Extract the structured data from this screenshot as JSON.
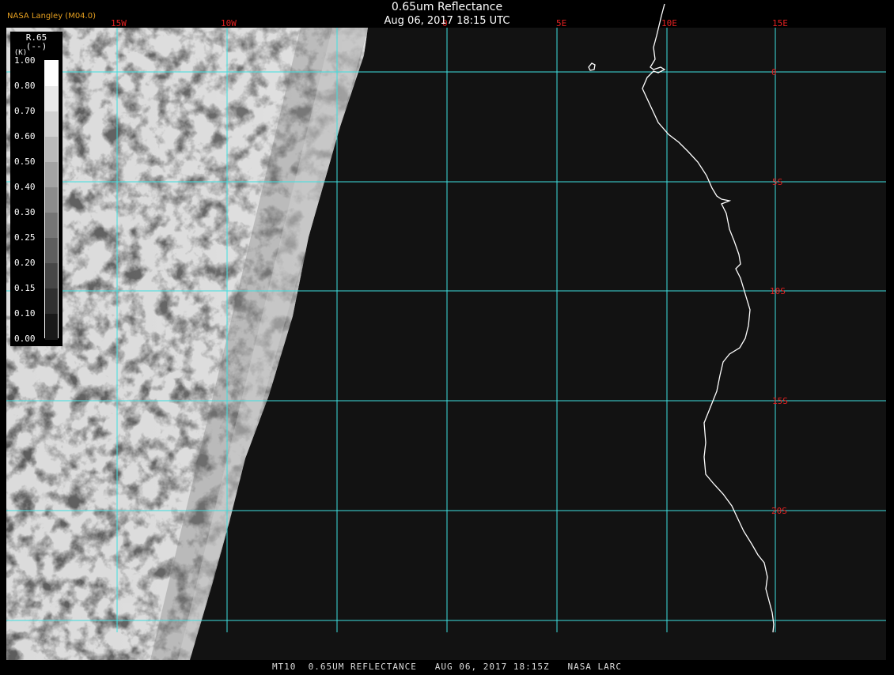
{
  "header": {
    "agency": "NASA Langley (M04.0)",
    "title": "0.65um Reflectance",
    "subtitle": "Aug 06, 2017 18:15 UTC"
  },
  "footer": {
    "text": "MT10  0.65UM REFLECTANCE   AUG 06, 2017 18:15Z   NASA LARC"
  },
  "legend": {
    "variable": "R.65",
    "units": "(--)",
    "scale_label": "(K)",
    "ticks": [
      "1.00",
      "0.80",
      "0.70",
      "0.60",
      "0.50",
      "0.40",
      "0.30",
      "0.25",
      "0.20",
      "0.15",
      "0.10",
      "0.00"
    ]
  },
  "map": {
    "lon_labels": [
      "15W",
      "10W",
      "0",
      "5E",
      "10E",
      "15E"
    ],
    "lat_labels": [
      "0",
      "5S",
      "10S",
      "15S",
      "20S"
    ],
    "colors": {
      "grid": "#3fe0e0",
      "grid_label": "#e02020",
      "coastline": "#ffffff",
      "background": "#111111"
    }
  }
}
